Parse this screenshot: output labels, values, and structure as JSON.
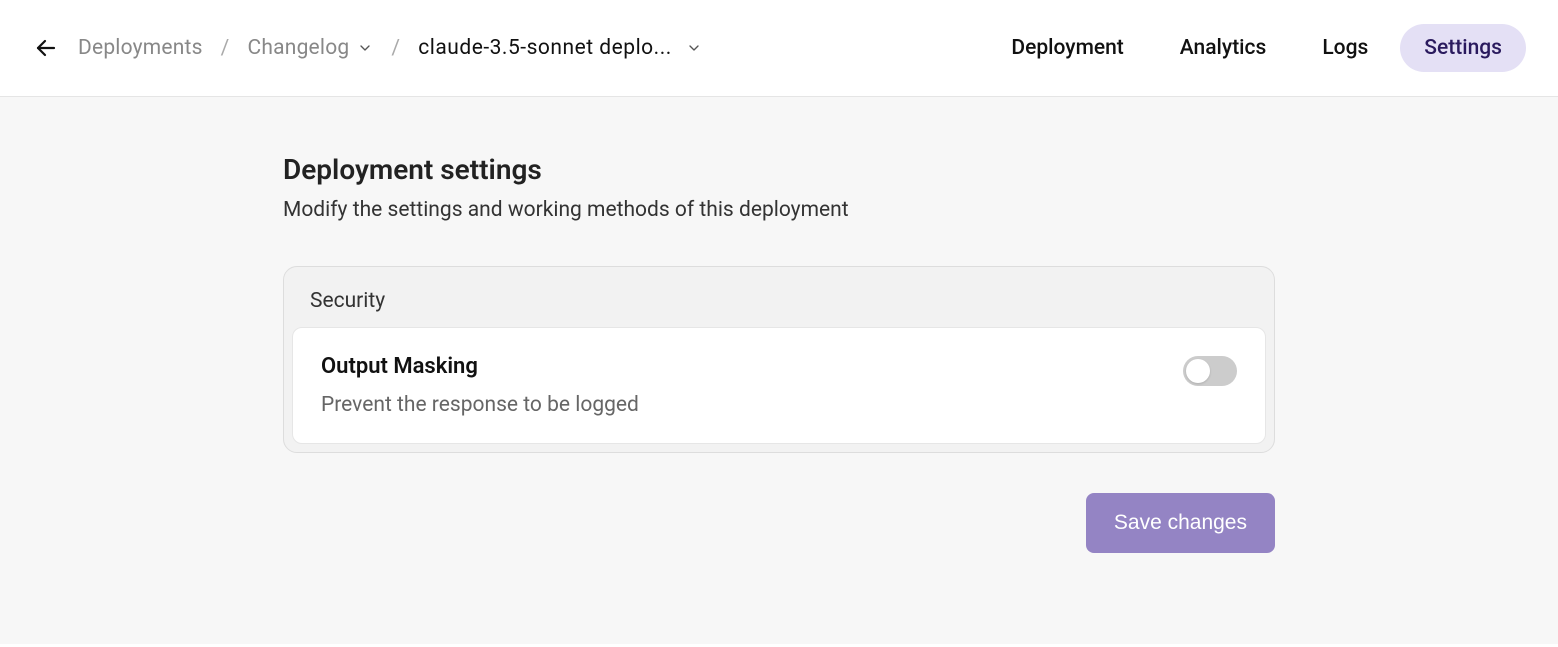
{
  "breadcrumb": {
    "root": "Deployments",
    "parent": "Changelog",
    "current": "claude-3.5-sonnet deplo..."
  },
  "tabs": {
    "deployment": "Deployment",
    "analytics": "Analytics",
    "logs": "Logs",
    "settings": "Settings",
    "active": "settings"
  },
  "page": {
    "title": "Deployment settings",
    "subtitle": "Modify the settings and working methods of this deployment"
  },
  "security": {
    "section_title": "Security",
    "output_masking": {
      "title": "Output Masking",
      "description": "Prevent the response to be logged",
      "enabled": false
    }
  },
  "actions": {
    "save": "Save changes"
  }
}
